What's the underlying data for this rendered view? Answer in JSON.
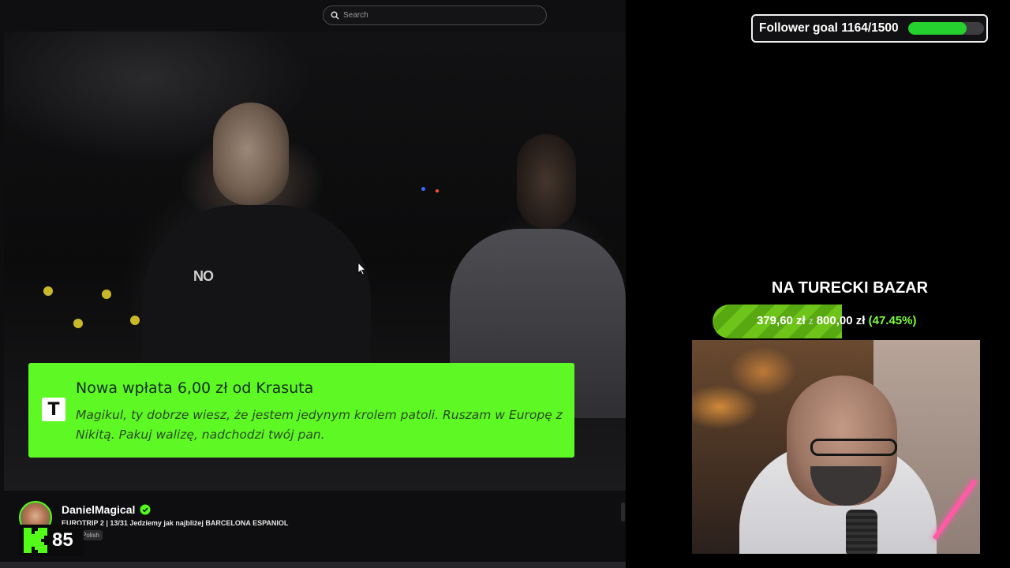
{
  "search": {
    "placeholder": "Search"
  },
  "alert": {
    "logo_letter": "T",
    "title": "Nowa wpłata 6,00 zł od Krasuta",
    "message": "Magikul, ty dobrze wiesz, że jestem jedynym krolem patoli. Ruszam w Europę z Nikitą. Pakuj walizę, nadchodzi twój pan."
  },
  "video": {
    "shirt_text": "NO"
  },
  "channel": {
    "name": "DanielMagical",
    "stream_title": "EUROTRIP 2 | 13/31 Jedziemy jak najbliżej BARCELONA ESPANIOL",
    "language": "Polish",
    "badge_number": "85"
  },
  "follower_goal": {
    "label": "Follower goal 1164/1500",
    "current": 1164,
    "target": 1500
  },
  "donation_goal": {
    "title": "NA TURECKI BAZAR",
    "current": "379,60 zł",
    "separator": "z",
    "target": "800,00 zł",
    "percent_label": "(47.45%)",
    "percent": 47.45
  },
  "colors": {
    "kick_green": "#53fc18",
    "alert_bg": "#5ef825",
    "goal_fill": "#24d12e",
    "bazar_fill": "#6fc41a"
  }
}
